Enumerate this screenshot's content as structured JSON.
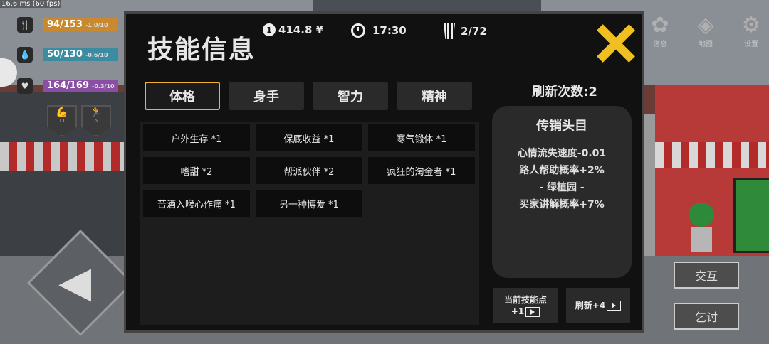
{
  "fps_text": "16.6 ms (60 fps)",
  "stats": [
    {
      "value": "94/153",
      "delta": "-1.0/10",
      "color": "#c8892f",
      "icon": "fork-knife-icon",
      "glyph": "🍴"
    },
    {
      "value": "50/130",
      "delta": "-0.6/10",
      "color": "#3b8ca0",
      "icon": "water-drop-icon",
      "glyph": "💧"
    },
    {
      "value": "164/169",
      "delta": "-0.3/10",
      "color": "#8a4fa5",
      "icon": "heart-icon",
      "glyph": "♥"
    }
  ],
  "buffs": [
    {
      "icon": "muscle-icon",
      "glyph": "💪",
      "count": "11"
    },
    {
      "icon": "running-icon",
      "glyph": "🏃",
      "count": "5"
    }
  ],
  "right_menu": [
    {
      "label": "信息",
      "icon": "info-icon",
      "glyph": "✿"
    },
    {
      "label": "地图",
      "icon": "map-icon",
      "glyph": "◈"
    },
    {
      "label": "设置",
      "icon": "gear-icon",
      "glyph": "⚙"
    }
  ],
  "actions": {
    "interact": "交互",
    "beg": "乞讨"
  },
  "dialog": {
    "title": "技能信息",
    "money": "414.8 ¥",
    "coin_label": "1",
    "time": "17:30",
    "cup_count": "2/72",
    "tabs": [
      "体格",
      "身手",
      "智力",
      "精神"
    ],
    "active_tab": 0,
    "skills": [
      "户外生存 *1",
      "保底收益 *1",
      "寒气锻体 *1",
      "嗜甜 *2",
      "帮派伙伴 *2",
      "疯狂的淘金者 *1",
      "苦酒入喉心作痛 *1",
      "另一种博爱 *1"
    ],
    "refresh_count": "刷新次数:2",
    "panel": {
      "title": "传销头目",
      "lines": [
        "心情流失速度-0.01",
        "路人帮助概率+2%",
        "- 绿植园 -",
        "买家讲解概率+7%"
      ]
    },
    "skill_points": {
      "line1": "当前技能点",
      "line2": "+1"
    },
    "refresh_btn": "刷新+4"
  },
  "colors": {
    "accent": "#f0b030",
    "close": "#f0c020"
  }
}
